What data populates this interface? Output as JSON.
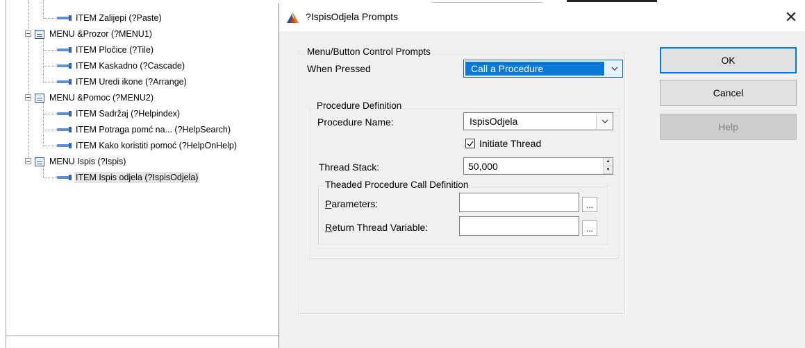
{
  "tree": {
    "items": [
      {
        "type": "item",
        "label": "ITEM  Zalijepi  (?Paste)"
      },
      {
        "type": "menu",
        "label": "MENU  &Prozor (?MENU1)"
      },
      {
        "type": "item",
        "label": "ITEM  Pločice  (?Tile)"
      },
      {
        "type": "item",
        "label": "ITEM  Kaskadno  (?Cascade)"
      },
      {
        "type": "item",
        "label": "ITEM  Uredi ikone  (?Arrange)"
      },
      {
        "type": "menu",
        "label": "MENU  &Pomoc (?MENU2)"
      },
      {
        "type": "item",
        "label": "ITEM  Sadržaj  (?Helpindex)"
      },
      {
        "type": "item",
        "label": "ITEM  Potraga pomć na...  (?HelpSearch)"
      },
      {
        "type": "item",
        "label": "ITEM  Kako koristiti pomoć  (?HelpOnHelp)"
      },
      {
        "type": "menu",
        "label": "MENU  Ispis (?Ispis)"
      },
      {
        "type": "item",
        "label": "ITEM  Ispis odjela  (?IspisOdjela)"
      }
    ]
  },
  "dialog": {
    "title": "?IspisOdjela Prompts",
    "close_glyph": "✕",
    "group_menu": {
      "legend": "Menu/Button Control Prompts",
      "when_pressed_label": "When Pressed",
      "when_pressed_value": "Call a Procedure"
    },
    "group_procedure": {
      "legend": "Procedure Definition",
      "procedure_name_label": "Procedure Name:",
      "procedure_name_value": "IspisOdjela",
      "initiate_thread_label": "Initiate Thread",
      "initiate_thread_checked": true,
      "thread_stack_label": "Thread Stack:",
      "thread_stack_value": "50,000"
    },
    "group_threaded": {
      "legend": "Theaded Procedure Call Definition",
      "parameters_label_first": "P",
      "parameters_label_rest": "arameters:",
      "parameters_value": "",
      "return_label_first": "R",
      "return_label_rest": "eturn Thread Variable:",
      "return_value": "",
      "ellipsis": "..."
    },
    "buttons": {
      "ok": "OK",
      "cancel": "Cancel",
      "help": "Help"
    }
  }
}
